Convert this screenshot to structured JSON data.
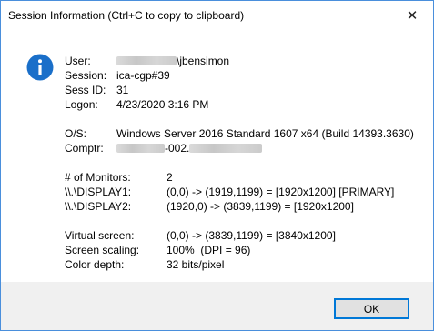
{
  "window": {
    "title": "Session Information (Ctrl+C to copy to clipboard)",
    "close_symbol": "✕"
  },
  "icon": "info-icon",
  "session": {
    "user_label": "User:",
    "user_value": "\\jbensimon",
    "session_label": "Session:",
    "session_value": "ica-cgp#39",
    "sessid_label": "Sess ID:",
    "sessid_value": "31",
    "logon_label": "Logon:",
    "logon_value": "4/23/2020 3:16 PM"
  },
  "system": {
    "os_label": "O/S:",
    "os_value": "Windows Server 2016 Standard 1607 x64 (Build 14393.3630)",
    "comptr_label": "Comptr:",
    "comptr_value": "-002."
  },
  "monitors": {
    "count_label": "# of Monitors:",
    "count_value": "2",
    "display1_label": "\\\\.\\DISPLAY1:",
    "display1_value": "(0,0) -> (1919,1199) = [1920x1200] [PRIMARY]",
    "display2_label": "\\\\.\\DISPLAY2:",
    "display2_value": "(1920,0) -> (3839,1199) = [1920x1200]"
  },
  "screen": {
    "virtual_label": "Virtual screen:",
    "virtual_value": "(0,0) -> (3839,1199) = [3840x1200]",
    "scaling_label": "Screen scaling:",
    "scaling_value": "100%  (DPI = 96)",
    "depth_label": "Color depth:",
    "depth_value": "32 bits/pixel"
  },
  "footer": {
    "ok_label": "OK"
  },
  "colors": {
    "accent": "#0078d7",
    "icon_blue": "#1a6fc9",
    "footer_bg": "#f0f0f0"
  }
}
